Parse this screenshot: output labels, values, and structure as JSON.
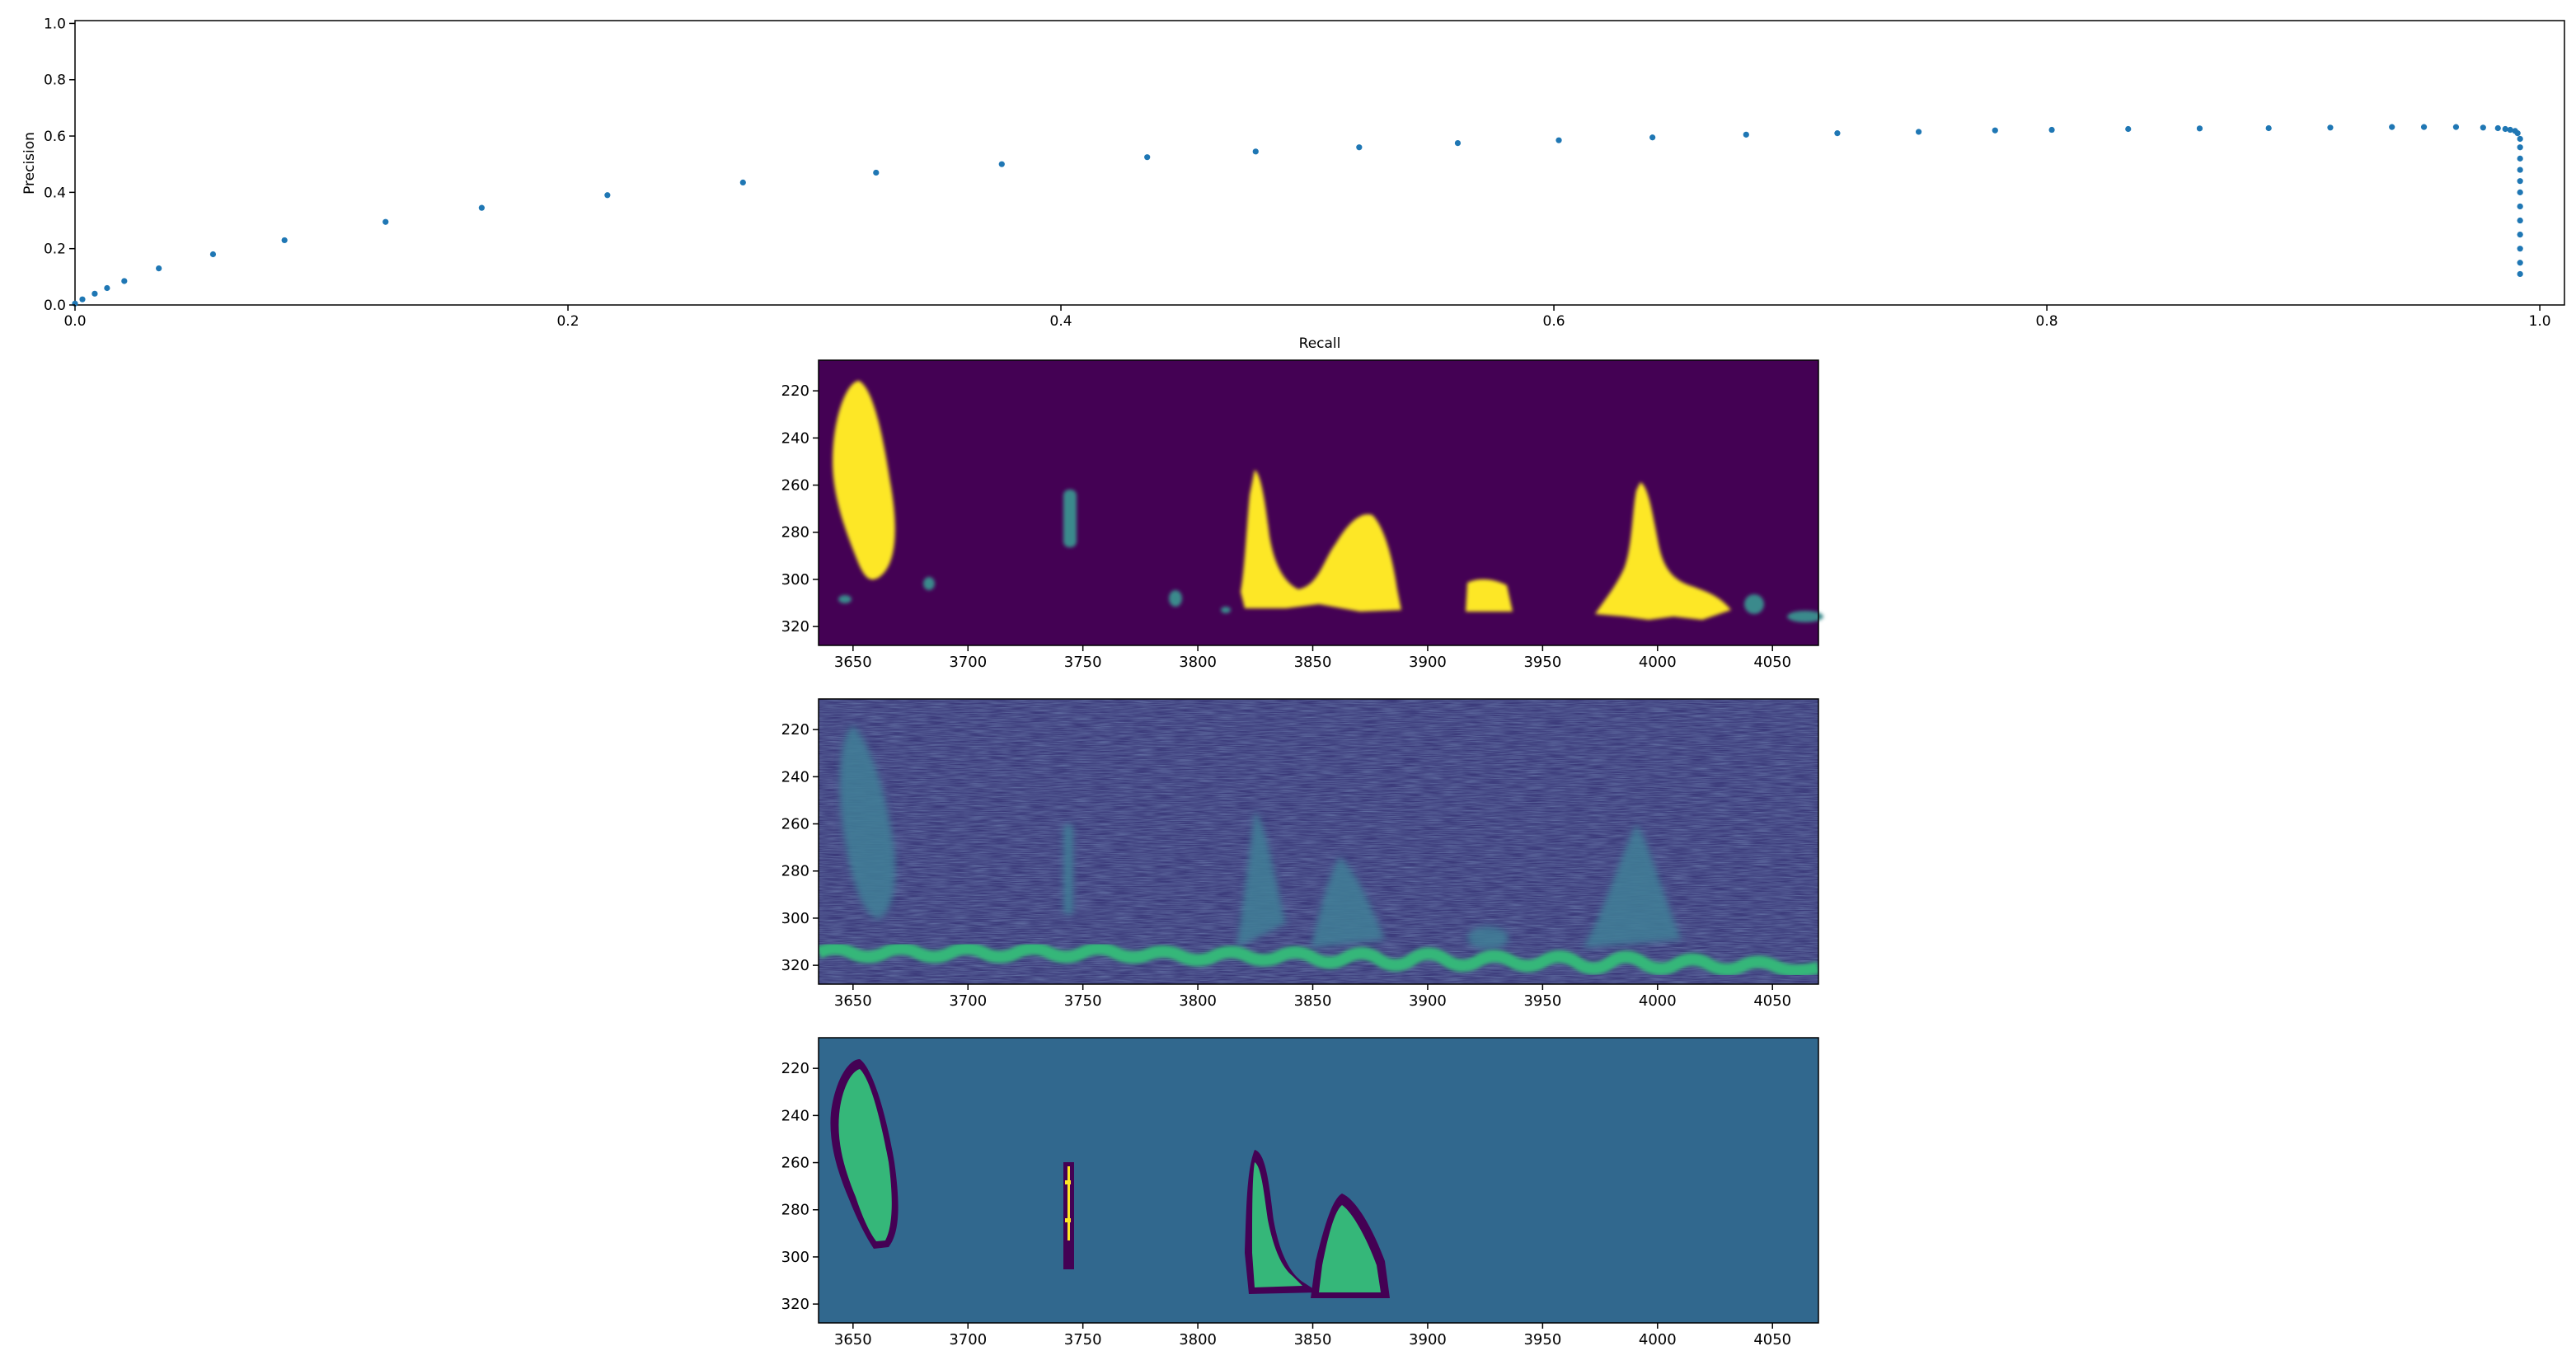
{
  "chart_data": [
    {
      "type": "scatter",
      "xlabel": "Recall",
      "ylabel": "Precision",
      "xlim": [
        0.0,
        1.01
      ],
      "ylim": [
        0.0,
        1.01
      ],
      "xticks": [
        0.0,
        0.2,
        0.4,
        0.6,
        0.8,
        1.0
      ],
      "xtick_labels": [
        "0.0",
        "0.2",
        "0.4",
        "0.6",
        "0.8",
        "1.0"
      ],
      "yticks": [
        0.0,
        0.2,
        0.4,
        0.6,
        0.8,
        1.0
      ],
      "ytick_labels": [
        "0.0",
        "0.2",
        "0.4",
        "0.6",
        "0.8",
        "1.0"
      ],
      "grid": false,
      "legend": "none",
      "color": "#1f77b4",
      "x": [
        0.0,
        0.003,
        0.008,
        0.013,
        0.02,
        0.034,
        0.056,
        0.085,
        0.126,
        0.165,
        0.216,
        0.271,
        0.325,
        0.376,
        0.435,
        0.479,
        0.521,
        0.561,
        0.602,
        0.64,
        0.678,
        0.715,
        0.748,
        0.779,
        0.802,
        0.833,
        0.862,
        0.89,
        0.915,
        0.94,
        0.953,
        0.966,
        0.977,
        0.983,
        0.986,
        0.988,
        0.99,
        0.991,
        0.992,
        0.992,
        0.992,
        0.992,
        0.992,
        0.992,
        0.992,
        0.992,
        0.992,
        0.992,
        0.992,
        0.992
      ],
      "y": [
        0.005,
        0.02,
        0.04,
        0.06,
        0.085,
        0.13,
        0.18,
        0.23,
        0.295,
        0.345,
        0.39,
        0.435,
        0.47,
        0.5,
        0.525,
        0.545,
        0.56,
        0.575,
        0.585,
        0.595,
        0.605,
        0.61,
        0.615,
        0.62,
        0.622,
        0.625,
        0.627,
        0.628,
        0.63,
        0.632,
        0.632,
        0.632,
        0.63,
        0.628,
        0.625,
        0.622,
        0.618,
        0.61,
        0.59,
        0.56,
        0.52,
        0.48,
        0.44,
        0.4,
        0.35,
        0.3,
        0.25,
        0.2,
        0.15,
        0.11
      ]
    },
    {
      "type": "heatmap",
      "colormap": "viridis",
      "xticks": [
        3650,
        3700,
        3750,
        3800,
        3850,
        3900,
        3950,
        4000,
        4050
      ],
      "xtick_labels": [
        "3650",
        "3700",
        "3750",
        "3800",
        "3850",
        "3900",
        "3950",
        "4000",
        "4050"
      ],
      "yticks": [
        220,
        240,
        260,
        280,
        300,
        320
      ],
      "ytick_labels": [
        "220",
        "240",
        "260",
        "280",
        "300",
        "320"
      ],
      "xlim": [
        3635,
        4070
      ],
      "ylim": [
        328,
        207
      ]
    },
    {
      "type": "heatmap",
      "colormap": "viridis",
      "xticks": [
        3650,
        3700,
        3750,
        3800,
        3850,
        3900,
        3950,
        4000,
        4050
      ],
      "xtick_labels": [
        "3650",
        "3700",
        "3750",
        "3800",
        "3850",
        "3900",
        "3950",
        "4000",
        "4050"
      ],
      "yticks": [
        220,
        240,
        260,
        280,
        300,
        320
      ],
      "ytick_labels": [
        "220",
        "240",
        "260",
        "280",
        "300",
        "320"
      ],
      "xlim": [
        3635,
        4070
      ],
      "ylim": [
        328,
        207
      ]
    },
    {
      "type": "heatmap",
      "colormap": "viridis",
      "xticks": [
        3650,
        3700,
        3750,
        3800,
        3850,
        3900,
        3950,
        4000,
        4050
      ],
      "xtick_labels": [
        "3650",
        "3700",
        "3750",
        "3800",
        "3850",
        "3900",
        "3950",
        "4000",
        "4050"
      ],
      "yticks": [
        220,
        240,
        260,
        280,
        300,
        320
      ],
      "ytick_labels": [
        "220",
        "240",
        "260",
        "280",
        "300",
        "320"
      ],
      "xlim": [
        3635,
        4070
      ],
      "ylim": [
        328,
        207
      ]
    }
  ]
}
